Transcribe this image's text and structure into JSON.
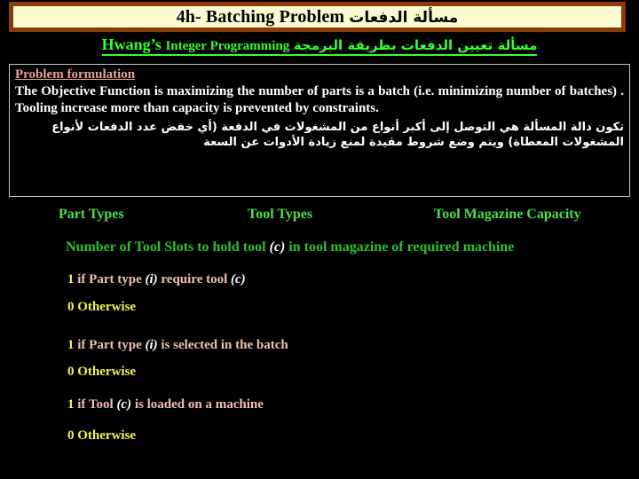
{
  "slide": {
    "background_color": "#000000",
    "title": {
      "english": "4h- Batching Problem",
      "arabic": "مسألة الدفعات",
      "fill_color": "#FDFBD0",
      "border_color": "#8C3A09",
      "text_color": "#000000"
    },
    "subtitle": {
      "name_part": "Hwang’s",
      "method_part": "Integer Programming",
      "arabic": "مسألة تعيين الدفعات بطريقة البرمجة",
      "color": "#33FF33"
    },
    "content_box": {
      "border_color": "#C8C8C8",
      "heading": "Problem formulation",
      "heading_color": "#E8A090",
      "paragraph": "The Objective Function is maximizing the number of parts is  a batch (i.e. minimizing number of batches) . Tooling increase more than capacity is prevented by constraints.",
      "paragraph_color": "#FFFFFF",
      "arabic_paragraph": "تكون دالة المسألة هي التوصل إلى أكبر أنواع من المشغولات في الدفعة (أي  خفض عدد الدفعات لأنواع المشغولات المعطاة) ويتم وضع شروط مقيدة لمنع زيادة الأدوات عن السعة"
    },
    "labels": {
      "color": "#4CE04C",
      "part_types": "Part Types",
      "tool_types": "Tool Types",
      "tool_magazine_capacity": "Tool Magazine Capacity"
    },
    "slots_line": {
      "color": "#2FBF2F",
      "before": "Number of Tool Slots to hold tool ",
      "variable": "(c)",
      "after": " in tool magazine of required machine"
    },
    "definitions": [
      {
        "number": "1",
        "text_before": " if Part type ",
        "variable_1": "(i)",
        "text_middle": " require tool ",
        "variable_2": "(c)",
        "text_after": "",
        "number_color": "#F2F24A",
        "text_color": "#F0BFB2"
      },
      {
        "number": "0",
        "text_before": " Otherwise",
        "variable_1": "",
        "text_middle": "",
        "variable_2": "",
        "text_after": "",
        "number_color": "#F2F24A",
        "text_color": "#F2F24A"
      },
      {
        "number": "1",
        "text_before": " if Part type ",
        "variable_1": "(i)",
        "text_middle": " is selected in the batch",
        "variable_2": "",
        "text_after": "",
        "number_color": "#F2F24A",
        "text_color": "#F0BFB2"
      },
      {
        "number": "0",
        "text_before": " Otherwise",
        "variable_1": "",
        "text_middle": "",
        "variable_2": "",
        "text_after": "",
        "number_color": "#F2F24A",
        "text_color": "#F2F24A"
      },
      {
        "number": "1",
        "text_before": " if Tool ",
        "variable_1": "(c)",
        "text_middle": " is loaded on a machine",
        "variable_2": "",
        "text_after": "",
        "number_color": "#F2F24A",
        "text_color": "#F0BFB2"
      },
      {
        "number": "0",
        "text_before": " Otherwise",
        "variable_1": "",
        "text_middle": "",
        "variable_2": "",
        "text_after": "",
        "number_color": "#F2F24A",
        "text_color": "#F2F24A"
      }
    ]
  }
}
